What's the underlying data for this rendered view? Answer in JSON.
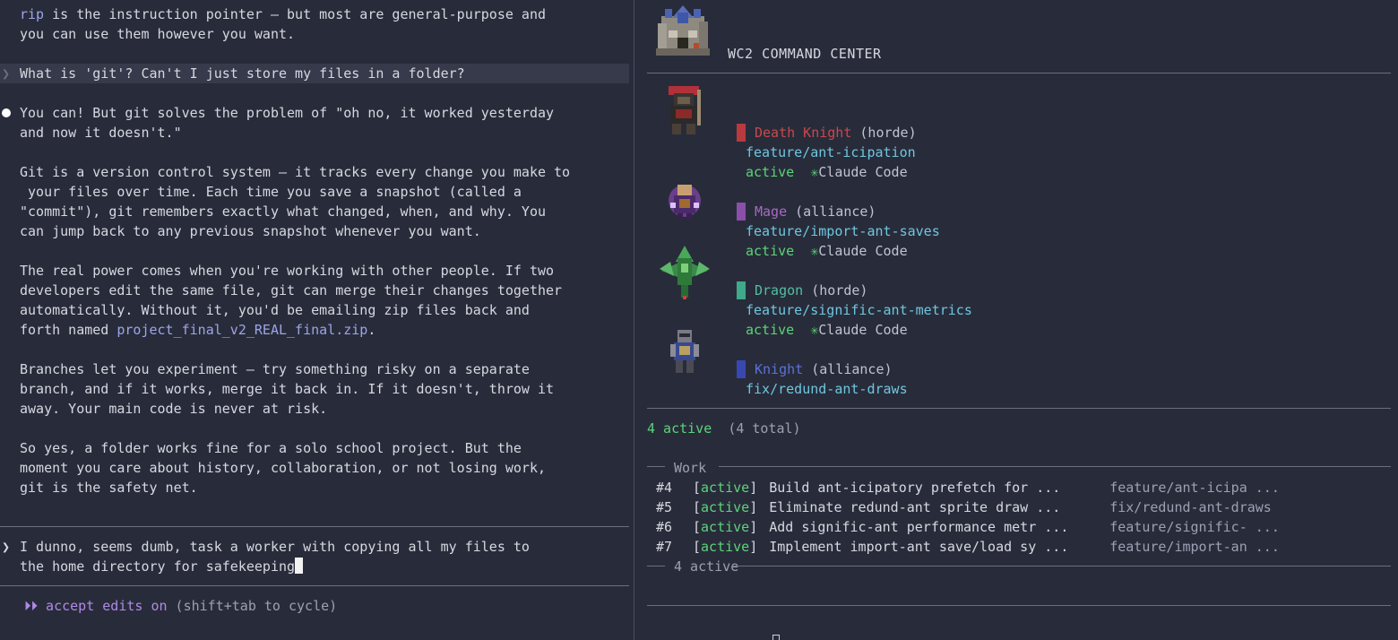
{
  "left": {
    "prev_lines": [
      {
        "code": "rip",
        "rest": " is the instruction pointer — but most are general-purpose and"
      },
      "you can use them however you want."
    ],
    "user_question": "What is 'git'? Can't I just store my files in a folder?",
    "user_marker": "❯",
    "answer_lines": [
      "You can! But git solves the problem of \"oh no, it worked yesterday",
      "and now it doesn't.\"",
      "",
      "Git is a version control system — it tracks every change you make to",
      " your files over time. Each time you save a snapshot (called a",
      "\"commit\"), git remembers exactly what changed, when, and why. You",
      "can jump back to any previous snapshot whenever you want.",
      "",
      "The real power comes when you're working with other people. If two",
      "developers edit the same file, git can merge their changes together",
      "automatically. Without it, you'd be emailing zip files back and"
    ],
    "forth_prefix": "forth named ",
    "forth_link": "project_final_v2_REAL_final.zip",
    "forth_suffix": ".",
    "answer_lines_2": [
      "Branches let you experiment — try something risky on a separate",
      "branch, and if it works, merge it back in. If it doesn't, throw it",
      "away. Your main code is never at risk.",
      "",
      "So yes, a folder works fine for a solo school project. But the",
      "moment you care about history, collaboration, or not losing work,",
      "git is the safety net."
    ],
    "prompt_marker": "❯",
    "prompt_line_1": "I dunno, seems dumb, task a worker with copying all my files to",
    "prompt_line_2": "the home directory for safekeeping",
    "mode_icon": "⏵⏵",
    "mode_label": "accept edits on",
    "mode_hint": "(shift+tab to cycle)"
  },
  "right": {
    "title": "WC2 COMMAND CENTER",
    "workers": [
      {
        "unit": "Death Knight",
        "faction": "(horde)",
        "branch": "feature/ant-icipation",
        "status": "active",
        "agent_icon": "✳",
        "agent": "Claude Code",
        "color": "#b83a3e",
        "name_color": "#c9484c"
      },
      {
        "unit": "Mage",
        "faction": "(alliance)",
        "branch": "feature/import-ant-saves",
        "status": "active",
        "agent_icon": "✳",
        "agent": "Claude Code",
        "color": "#8a4fa8",
        "name_color": "#a868c6"
      },
      {
        "unit": "Dragon",
        "faction": "(horde)",
        "branch": "feature/signific-ant-metrics",
        "status": "active",
        "agent_icon": "✳",
        "agent": "Claude Code",
        "color": "#3fa98c",
        "name_color": "#52bfa0"
      },
      {
        "unit": "Knight",
        "faction": "(alliance)",
        "branch": "fix/redund-ant-draws",
        "color": "#3848b0",
        "name_color": "#5a72d8"
      }
    ],
    "summary_active": "4 active",
    "summary_total": "(4 total)",
    "work_label": "Work",
    "work_items": [
      {
        "id": "#4",
        "status": "active",
        "desc": "Build ant-icipatory prefetch for ...",
        "branch": "feature/ant-icipa ..."
      },
      {
        "id": "#5",
        "status": "active",
        "desc": "Eliminate redund-ant sprite draw ...",
        "branch": "fix/redund-ant-draws"
      },
      {
        "id": "#6",
        "status": "active",
        "desc": "Add signific-ant performance metr ...",
        "branch": "feature/signific- ..."
      },
      {
        "id": "#7",
        "status": "active",
        "desc": "Implement import-ant save/load sy ...",
        "branch": "feature/import-an ..."
      }
    ],
    "work_footer": "4 active",
    "colors": {
      "active_green": "#5dd37a",
      "branch_cyan": "#6fc6df",
      "accent_purple": "#b08ae6"
    }
  }
}
